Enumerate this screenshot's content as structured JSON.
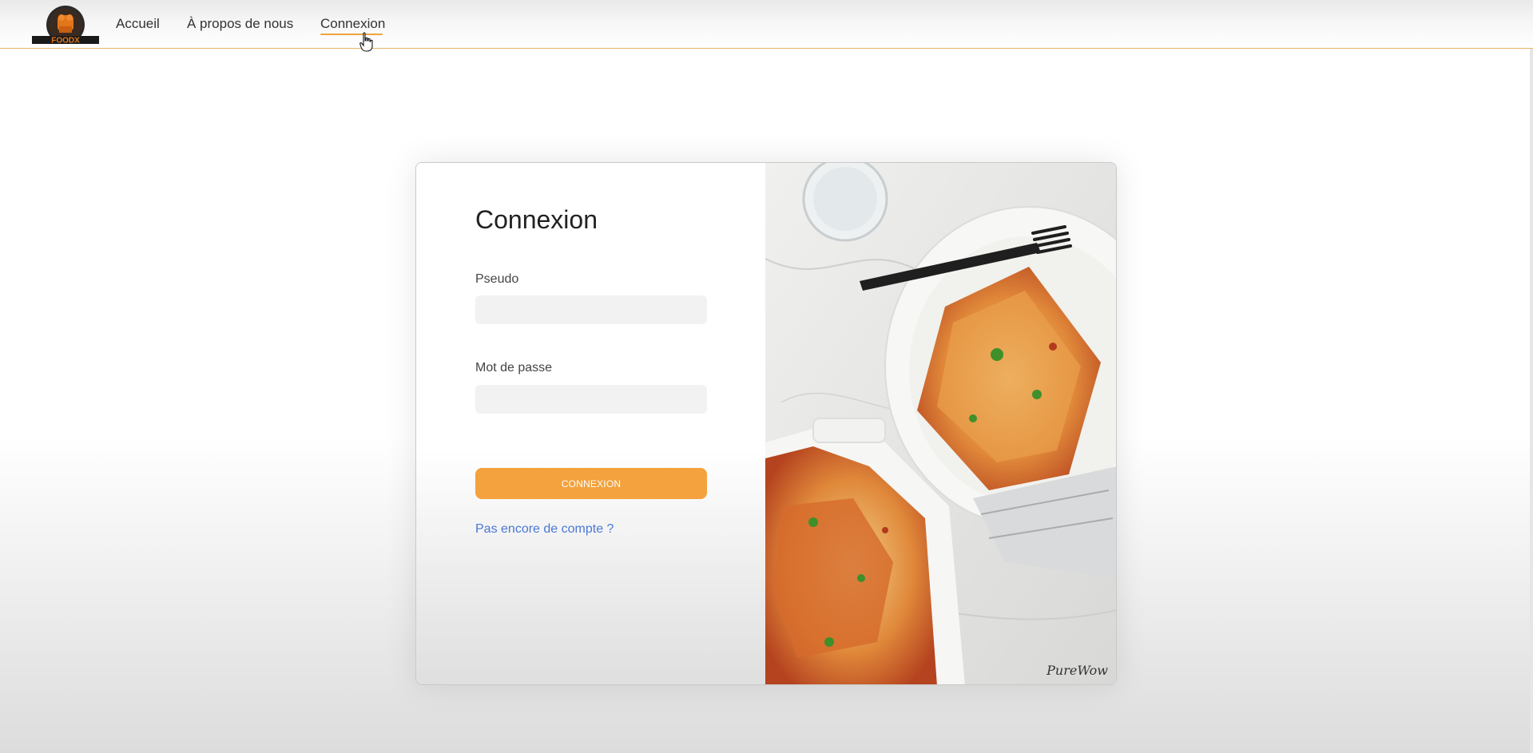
{
  "brand": {
    "logo_text": "FOODX",
    "logo_icon": "chef-hat-icon",
    "accent_color": "#f3a23e"
  },
  "nav": {
    "items": [
      {
        "label": "Accueil"
      },
      {
        "label": "À propos de nous"
      },
      {
        "label": "Connexion",
        "active": true
      }
    ]
  },
  "login": {
    "title": "Connexion",
    "username_label": "Pseudo",
    "username_value": "",
    "password_label": "Mot de passe",
    "password_value": "",
    "submit_label": "CONNEXION",
    "signup_link": "Pas encore de compte ?",
    "link_color": "#4a78d6"
  },
  "image": {
    "subject": "lasagna-photo",
    "watermark": "PureWow"
  }
}
